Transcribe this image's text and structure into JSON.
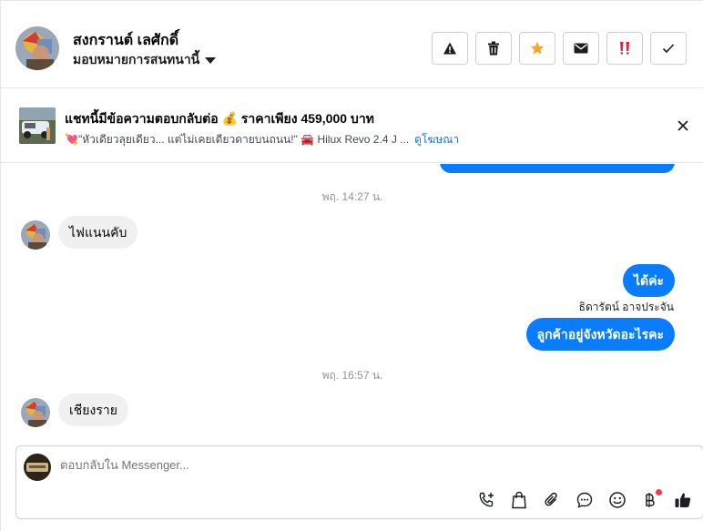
{
  "header": {
    "contact_name": "สงกรานต์ เลศักดิ์",
    "assign_label": "มอบหมายการสนทนานี้",
    "actions": [
      {
        "name": "report",
        "icon": "warning-icon"
      },
      {
        "name": "delete",
        "icon": "trash-icon"
      },
      {
        "name": "star",
        "icon": "star-icon",
        "color": "#f5a623"
      },
      {
        "name": "mark-unread",
        "icon": "envelope-icon"
      },
      {
        "name": "follow-up",
        "icon": "exclamation-icon",
        "color": "#e41e3f"
      },
      {
        "name": "mark-done",
        "icon": "check-icon"
      }
    ]
  },
  "ad_banner": {
    "title": "แชทนี้มีข้อความตอบกลับต่อ 💰 ราคาเพียง 459,000 บาท",
    "subtitle": "💘\"หัวเดียวลุยเดียว... แต่ไม่เคยเดียวดายบนถนน!\" 🚘 Hilux Revo 2.4 J ...",
    "link": "ดูโฆษณา"
  },
  "messages": [
    {
      "type": "timestamp",
      "text": "พฤ. 14:27 น."
    },
    {
      "type": "incoming",
      "text": "ไฟแนนคับ"
    },
    {
      "type": "outgoing",
      "text": "ได้ค่ะ"
    },
    {
      "type": "sender",
      "text": "ธิดารัตน์ อาจประจัน"
    },
    {
      "type": "outgoing",
      "text": "ลูกค้าอยู่จังหวัดอะไรคะ"
    },
    {
      "type": "timestamp",
      "text": "พฤ. 16:57 น."
    },
    {
      "type": "incoming",
      "text": "เชียงราย"
    }
  ],
  "composer": {
    "placeholder": "ตอบกลับใน Messenger...",
    "tools": [
      "phone-add-icon",
      "shopping-bag-icon",
      "paperclip-icon",
      "saved-reply-icon",
      "emoji-icon",
      "baht-icon",
      "thumbs-up-icon"
    ]
  },
  "colors": {
    "outgoing_bubble": "#0a7cff",
    "incoming_bubble": "#f0f0f0",
    "link": "#216fdb"
  }
}
